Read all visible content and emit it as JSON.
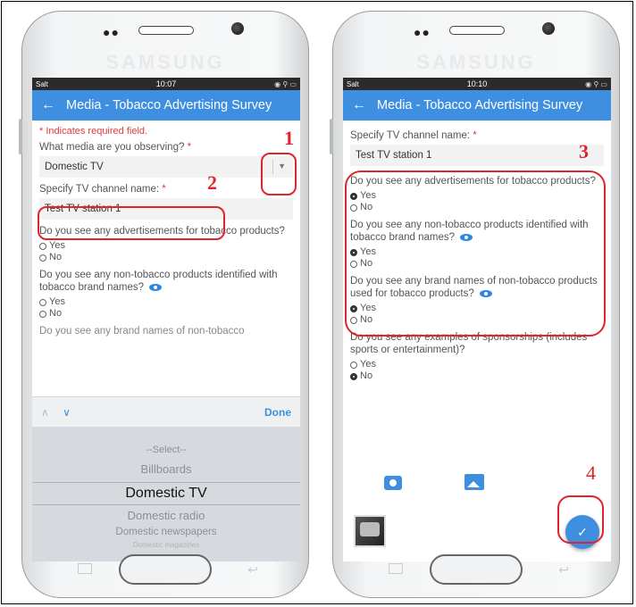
{
  "phone1": {
    "brand": "SAMSUNG",
    "status": {
      "carrier": "Salt",
      "time": "10:07"
    },
    "appbar": {
      "title": "Media - Tobacco Advertising Survey"
    },
    "required_note": "* Indicates required field.",
    "media_question": {
      "label": "What media are you observing?",
      "value": "Domestic TV"
    },
    "channel_question": {
      "label": "Specify TV channel name:",
      "value": "Test TV station 1"
    },
    "q_ads": {
      "label": "Do you see any advertisements for tobacco products?",
      "options": [
        "Yes",
        "No"
      ]
    },
    "q_brand": {
      "label": "Do you see any non-tobacco products identified with tobacco brand names?",
      "options": [
        "Yes",
        "No"
      ]
    },
    "q_partial": "Do you see any brand names of non-tobacco",
    "picker": {
      "done": "Done",
      "options": [
        "--Select--",
        "Billboards",
        "Domestic TV",
        "Domestic radio",
        "Domestic newspapers",
        "Domestic magazines"
      ],
      "selected": "Domestic TV"
    }
  },
  "phone2": {
    "brand": "SAMSUNG",
    "status": {
      "carrier": "Salt",
      "time": "10:10"
    },
    "appbar": {
      "title": "Media - Tobacco Advertising Survey"
    },
    "channel_question": {
      "label": "Specify TV channel name:",
      "value": "Test TV station 1"
    },
    "q_ads": {
      "label": "Do you see any advertisements for tobacco products?",
      "options": [
        "Yes",
        "No"
      ],
      "selected": "Yes"
    },
    "q_brand": {
      "label": "Do you see any non-tobacco products identified with tobacco brand names?",
      "options": [
        "Yes",
        "No"
      ],
      "selected": "Yes"
    },
    "q_brandnames": {
      "label": "Do you see any brand names of non-tobacco products used for tobacco products?",
      "options": [
        "Yes",
        "No"
      ],
      "selected": "Yes"
    },
    "q_sponsor": {
      "label": "Do you see any examples of sponsorships (includes sports or entertainment)?",
      "options": [
        "Yes",
        "No"
      ],
      "selected": "No"
    },
    "fab_icon": "✓"
  },
  "annotations": {
    "n1": "1",
    "n2": "2",
    "n3": "3",
    "n4": "4"
  },
  "colors": {
    "appbar": "#3f8fe0",
    "annotation": "#e0242b",
    "required": "#e03b3b"
  }
}
